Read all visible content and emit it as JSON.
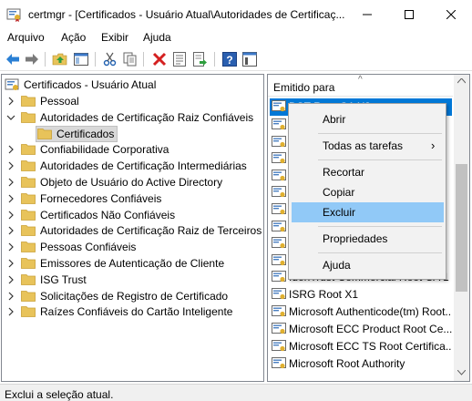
{
  "window": {
    "title": "certmgr - [Certificados - Usuário Atual\\Autoridades de Certificaç..."
  },
  "menu": {
    "items": [
      "Arquivo",
      "Ação",
      "Exibir",
      "Ajuda"
    ]
  },
  "toolbar": {
    "buttons": [
      "back-icon",
      "forward-icon",
      "up-folder-icon",
      "show-hide-tree-icon",
      "cut-icon",
      "copy-icon",
      "delete-icon",
      "properties-icon",
      "export-icon",
      "help-icon",
      "console-icon"
    ]
  },
  "tree": {
    "root": "Certificados - Usuário Atual",
    "items": [
      "Pessoal",
      "Autoridades de Certificação Raiz Confiáveis",
      "Certificados",
      "Confiabilidade Corporativa",
      "Autoridades de Certificação Intermediárias",
      "Objeto de Usuário do Active Directory",
      "Fornecedores Confiáveis",
      "Certificados Não Confiáveis",
      "Autoridades de Certificação Raiz de Terceiros",
      "Pessoas Confiáveis",
      "Emissores de Autenticação de Cliente",
      "ISG Trust",
      "Solicitações de Registro de Certificado",
      "Raízes Confiáveis do Cartão Inteligente"
    ]
  },
  "list": {
    "header": "Emitido para",
    "sort_glyph": "^",
    "rows": [
      "DST Root CA X3",
      "IdenTrust Commercial Root CA 1",
      "ISRG Root X1",
      "Microsoft Authenticode(tm) Root...",
      "Microsoft ECC Product Root Ce...",
      "Microsoft ECC TS Root Certifica...",
      "Microsoft Root Authority"
    ]
  },
  "context_menu": {
    "items": [
      "Abrir",
      "Todas as tarefas",
      "Recortar",
      "Copiar",
      "Excluir",
      "Propriedades",
      "Ajuda"
    ],
    "submenu_arrow": "›"
  },
  "status": {
    "text": "Exclui a seleção atual."
  },
  "colors": {
    "selection": "#0078d7",
    "menu_hover": "#91c9f7",
    "folder": "#e8c35a"
  }
}
